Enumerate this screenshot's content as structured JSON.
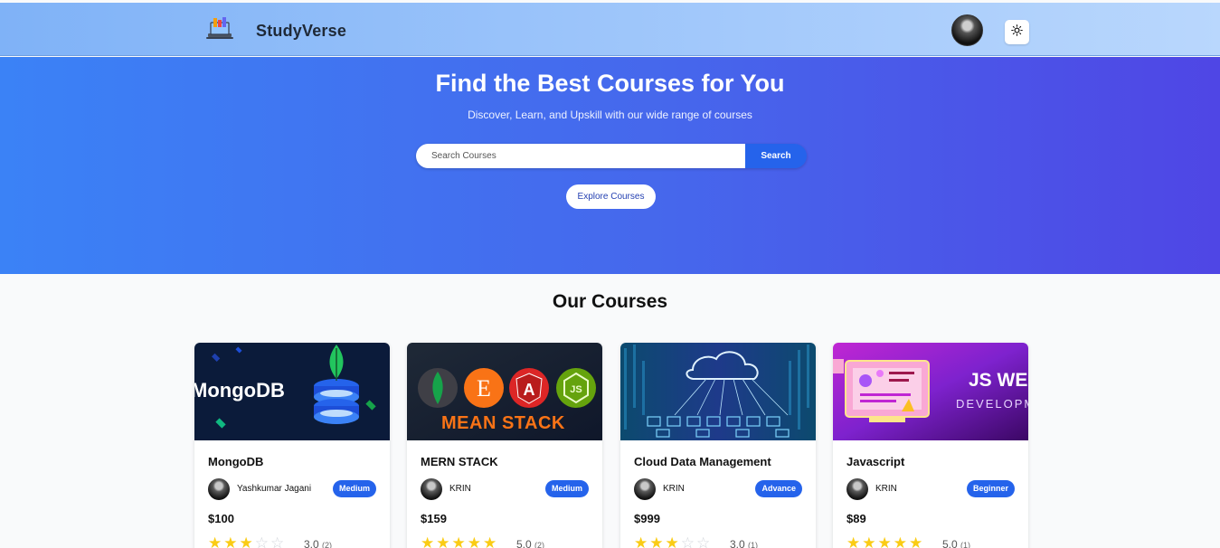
{
  "navbar": {
    "brand": "StudyVerse",
    "logo_icon": "laptop-books-icon",
    "avatar_icon": "user-avatar",
    "theme_icon": "sun-icon"
  },
  "hero": {
    "title": "Find the Best Courses for You",
    "subtitle": "Discover, Learn, and Upskill with our wide range of courses",
    "search_placeholder": "Search Courses",
    "search_button": "Search",
    "explore_button": "Explore Courses"
  },
  "courses": {
    "section_title": "Our Courses",
    "items": [
      {
        "title": "MongoDB",
        "thumb_text": "MongoDB",
        "instructor": "Yashkumar Jagani",
        "level": "Medium",
        "price": "$100",
        "rating": 3,
        "rating_text": "3.0",
        "rating_count": "(2)"
      },
      {
        "title": "MERN STACK",
        "thumb_text": "MEAN STACK",
        "instructor": "KRIN",
        "level": "Medium",
        "price": "$159",
        "rating": 5,
        "rating_text": "5.0",
        "rating_count": "(2)"
      },
      {
        "title": "Cloud Data Management",
        "thumb_text": "",
        "instructor": "KRIN",
        "level": "Advance",
        "price": "$999",
        "rating": 3,
        "rating_text": "3.0",
        "rating_count": "(1)"
      },
      {
        "title": "Javascript",
        "thumb_text": "JS WEB",
        "thumb_subtext": "DEVELOPM",
        "instructor": "KRIN",
        "level": "Beginner",
        "price": "$89",
        "rating": 5,
        "rating_text": "5.0",
        "rating_count": "(1)"
      }
    ]
  },
  "colors": {
    "primary": "#2563eb",
    "hero_start": "#3b82f6",
    "hero_end": "#4f46e5",
    "star": "#facc15"
  }
}
